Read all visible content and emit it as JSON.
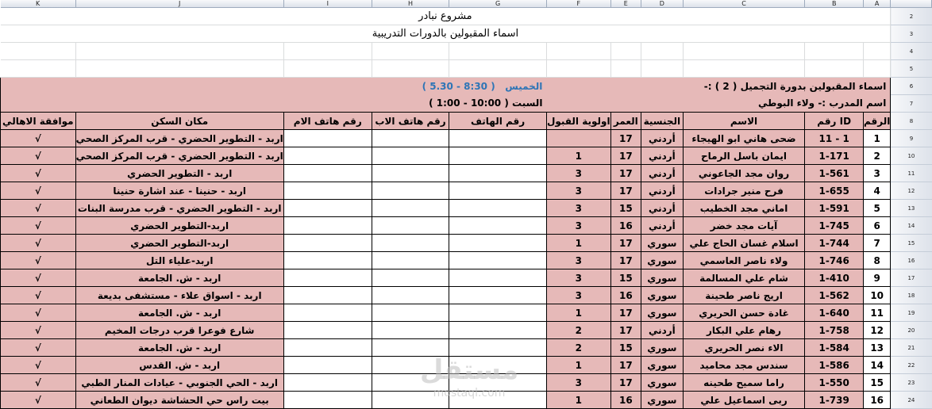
{
  "columns": [
    "K",
    "J",
    "I",
    "H",
    "G",
    "F",
    "E",
    "D",
    "C",
    "B",
    "A"
  ],
  "row_numbers": [
    "2",
    "3",
    "4",
    "5",
    "6",
    "7",
    "8",
    "9",
    "10",
    "11",
    "12",
    "13",
    "14",
    "15",
    "16",
    "17",
    "18",
    "19",
    "20",
    "21",
    "22",
    "23",
    "24"
  ],
  "title": {
    "line1": "مشروع نبادر",
    "line2": "اسماء المقبولين بالدورات التدريبية"
  },
  "info": {
    "course": "اسماء المقبولين بدورة التجميل ( 2 ) :-",
    "thursday_label": "الخميس",
    "thursday_time": "( 5.30 - 8:30 )",
    "trainer": "اسم المدرب :-  ولاء البوطي",
    "saturday": "السبت ( 10:00 - 1:00 )"
  },
  "headers": {
    "num": "الرقم",
    "id": "رقم ID",
    "name": "الاسم",
    "nationality": "الجنسية",
    "age": "العمر",
    "priority": "اولوية القبول",
    "phone": "رقم الهاتف",
    "father_phone": "رقم هاتف الاب",
    "mother_phone": "رقم هاتف الام",
    "address": "مكان السكن",
    "consent": "موافقة الاهالي"
  },
  "rows": [
    {
      "num": "1",
      "id": "11 - 1",
      "name": "ضحى هاني ابو الهيجاء",
      "nat": "أردني",
      "age": "17",
      "pri": "",
      "addr": "اربد - التطوير الحضري - قرب المركز الصحي",
      "ok": "√"
    },
    {
      "num": "2",
      "id": "1-171",
      "name": "ايمان  باسل الرماح",
      "nat": "أردني",
      "age": "17",
      "pri": "1",
      "addr": "اربد - التطوير الحضري - قرب المركز الصحي",
      "ok": "√"
    },
    {
      "num": "3",
      "id": "1-561",
      "name": "روان مجد الجاعوني",
      "nat": "أردني",
      "age": "17",
      "pri": "3",
      "addr": "اربد - التطوير الحضري",
      "ok": "√"
    },
    {
      "num": "4",
      "id": "1-655",
      "name": "فرح منير جرادات",
      "nat": "أردني",
      "age": "17",
      "pri": "3",
      "addr": "اربد - حنينا - عند اشارة حنينا",
      "ok": "√"
    },
    {
      "num": "5",
      "id": "1-591",
      "name": "اماني مجد الخطيب",
      "nat": "أردني",
      "age": "15",
      "pri": "3",
      "addr": "اربد - التطوير الحضري - قرب مدرسة البنات",
      "ok": "√"
    },
    {
      "num": "6",
      "id": "1-745",
      "name": "آيات مجد خضر",
      "nat": "أردني",
      "age": "16",
      "pri": "3",
      "addr": "اربد-التطوير الحضري",
      "ok": "√"
    },
    {
      "num": "7",
      "id": "1-744",
      "name": "اسلام غسان الحاج علي",
      "nat": "سوري",
      "age": "17",
      "pri": "1",
      "addr": "اربد-التطوير الحضري",
      "ok": "√"
    },
    {
      "num": "8",
      "id": "1-746",
      "name": "ولاء ناصر العاسمي",
      "nat": "سوري",
      "age": "17",
      "pri": "3",
      "addr": "اربد-علياء التل",
      "ok": "√"
    },
    {
      "num": "9",
      "id": "1-410",
      "name": "شام علي المسالمة",
      "nat": "سوري",
      "age": "15",
      "pri": "3",
      "addr": "اربد - ش. الجامعة",
      "ok": "√"
    },
    {
      "num": "10",
      "id": "1-562",
      "name": "اريج ناصر طحينة",
      "nat": "سوري",
      "age": "16",
      "pri": "3",
      "addr": "اربد - اسواق علاء - مستشفى بديعة",
      "ok": "√"
    },
    {
      "num": "11",
      "id": "1-640",
      "name": "غادة حسن الحريري",
      "nat": "سوري",
      "age": "17",
      "pri": "1",
      "addr": "اربد - ش. الجامعة",
      "ok": "√"
    },
    {
      "num": "12",
      "id": "1-758",
      "name": "رهام علي البكار",
      "nat": "أردني",
      "age": "17",
      "pri": "2",
      "addr": "شارع فوعرا قرب درجات المخيم",
      "ok": "√"
    },
    {
      "num": "13",
      "id": "1-584",
      "name": "الاء نصر الحريري",
      "nat": "سوري",
      "age": "15",
      "pri": "2",
      "addr": "اربد - ش. الجامعة",
      "ok": "√"
    },
    {
      "num": "14",
      "id": "1-586",
      "name": "سندس مجد محاميد",
      "nat": "سوري",
      "age": "17",
      "pri": "1",
      "addr": "اربد - ش. القدس",
      "ok": "√"
    },
    {
      "num": "15",
      "id": "1-550",
      "name": "راما سميح طحينه",
      "nat": "سوري",
      "age": "17",
      "pri": "3",
      "addr": "اربد - الحي الجنوبي - عيادات المنار الطبي",
      "ok": "√"
    },
    {
      "num": "16",
      "id": "1-739",
      "name": "ربى اسماعيل علي",
      "nat": "سوري",
      "age": "16",
      "pri": "1",
      "addr": "بيت راس حي الحشاشة ديوان الطعاني",
      "ok": "√"
    }
  ],
  "watermark": {
    "text": "مستقل",
    "url": "mostaql.com"
  },
  "colors": {
    "pink": "#e6b9b8",
    "header_gray": "#dde2ea",
    "accent_blue": "#2e75b6"
  }
}
